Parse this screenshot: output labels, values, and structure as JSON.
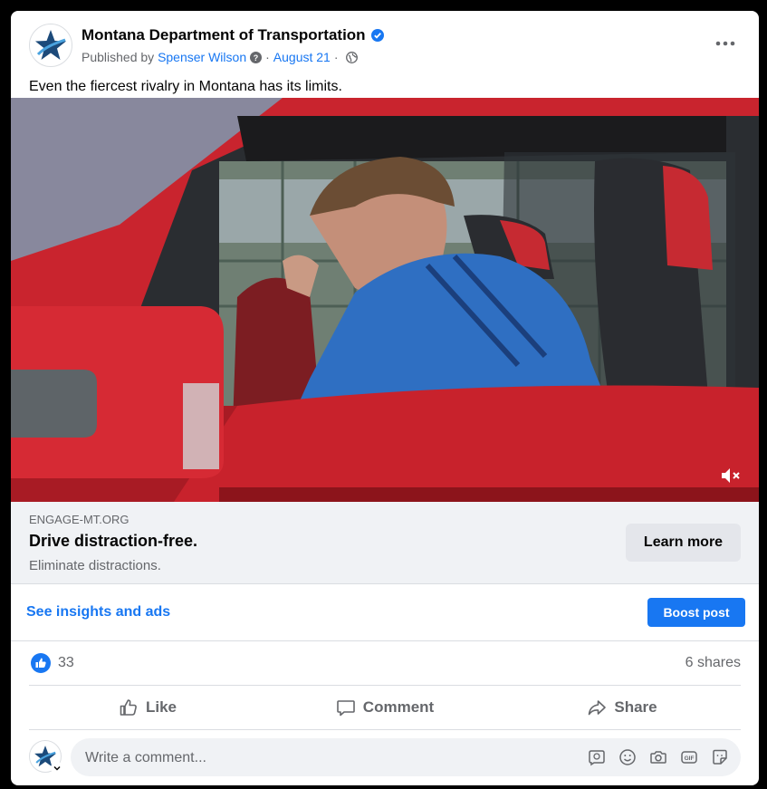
{
  "post": {
    "page_name": "Montana Department of Transportation",
    "published_by_prefix": "Published by",
    "author": "Spenser Wilson",
    "separator": "·",
    "date": "August 21",
    "text": "Even the fiercest rivalry in Montana has its limits."
  },
  "link_preview": {
    "domain": "ENGAGE-MT.ORG",
    "title": "Drive distraction-free.",
    "description": "Eliminate distractions.",
    "cta_label": "Learn more"
  },
  "insights": {
    "link_label": "See insights and ads",
    "boost_label": "Boost post"
  },
  "stats": {
    "reactions_count": "33",
    "shares": "6 shares"
  },
  "actions": {
    "like": "Like",
    "comment": "Comment",
    "share": "Share"
  },
  "comment_box": {
    "placeholder": "Write a comment..."
  },
  "colors": {
    "brand_blue": "#1877f2",
    "logo_navy": "#1c4a7a"
  },
  "icons": [
    "verified-badge-icon",
    "help-circle-icon",
    "globe-icon",
    "more-options-icon",
    "mute-icon",
    "like-reaction-icon",
    "thumbs-up-icon",
    "comment-icon",
    "share-icon",
    "avatar-sticker-icon",
    "emoji-icon",
    "camera-icon",
    "gif-icon",
    "sticker-icon"
  ]
}
